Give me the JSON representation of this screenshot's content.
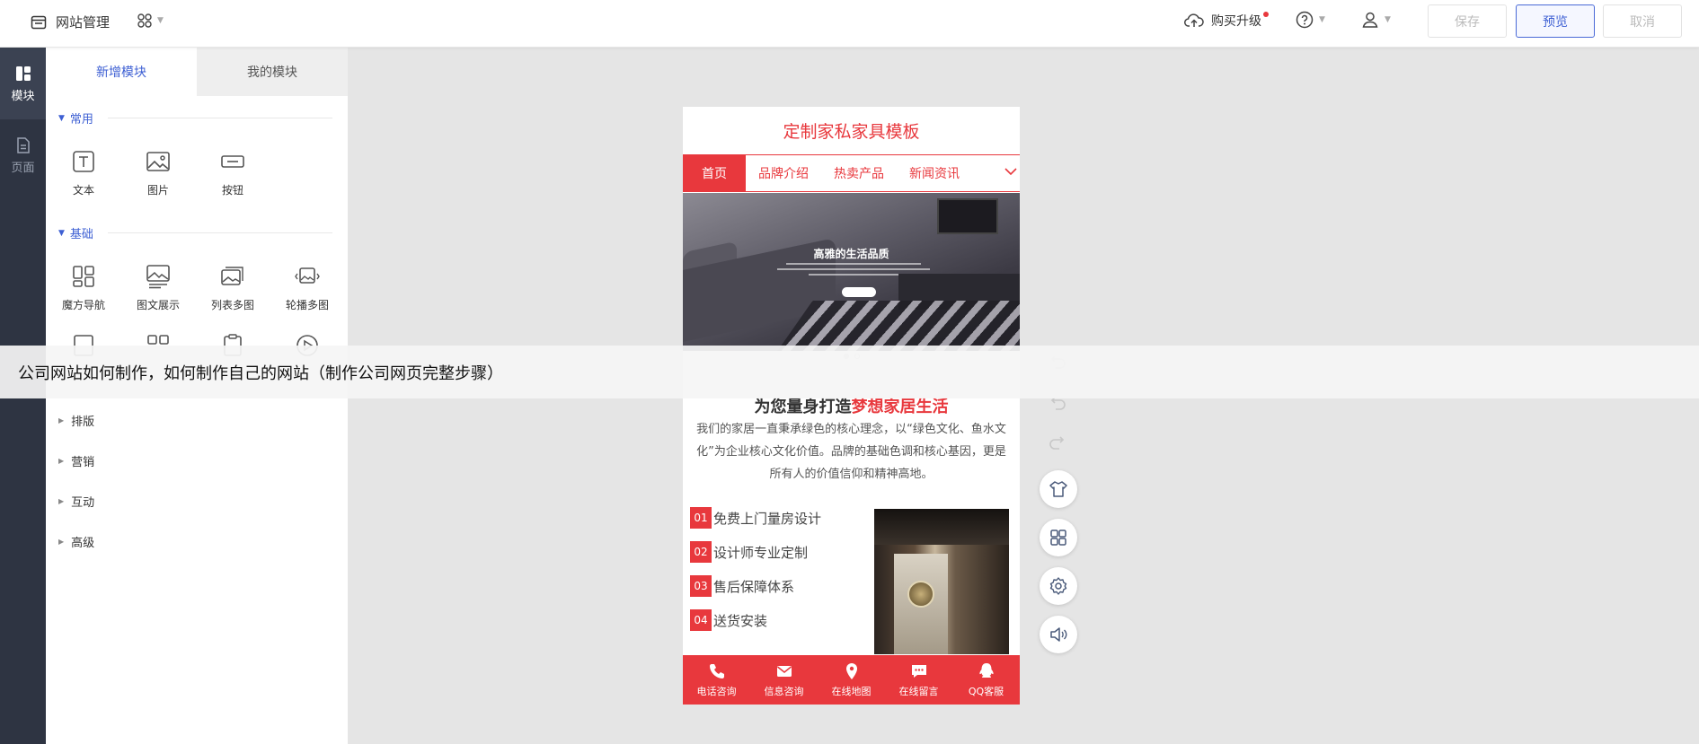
{
  "header": {
    "title": "网站管理",
    "upgrade_label": "购买升级",
    "save_label": "保存",
    "preview_label": "预览",
    "cancel_label": "取消"
  },
  "rail": {
    "items": [
      {
        "label": "模块",
        "icon": "module-icon"
      },
      {
        "label": "页面",
        "icon": "page-icon"
      }
    ]
  },
  "panel": {
    "tabs": [
      "新增模块",
      "我的模块"
    ],
    "sections": {
      "common": {
        "title": "常用",
        "items": [
          "文本",
          "图片",
          "按钮"
        ]
      },
      "basic": {
        "title": "基础",
        "items": [
          "魔方导航",
          "图文展示",
          "列表多图",
          "轮播多图"
        ]
      },
      "collapsed": [
        "排版",
        "营销",
        "互动",
        "高级"
      ]
    }
  },
  "phone": {
    "site_title": "定制家私家具模板",
    "nav": [
      "首页",
      "品牌介绍",
      "热卖产品",
      "新闻资讯"
    ],
    "banner_title": "高雅的生活品质",
    "slogan_black": "为您量身打造",
    "slogan_red": "梦想家居生活",
    "intro": "我们的家居一直秉承绿色的核心理念，以“绿色文化、鱼水文化”为企业核心文化价值。品牌的基础色调和核心基因，更是所有人的价值信仰和精神高地。",
    "features": [
      {
        "num": "01",
        "text": "免费上门量房设计"
      },
      {
        "num": "02",
        "text": "设计师专业定制"
      },
      {
        "num": "03",
        "text": "售后保障体系"
      },
      {
        "num": "04",
        "text": "送货安装"
      }
    ],
    "bottom_bar": [
      "电话咨询",
      "信息咨询",
      "在线地图",
      "在线留言",
      "QQ客服"
    ]
  },
  "overlay_caption": "公司网站如何制作，如何制作自己的网站（制作公司网页完整步骤）",
  "colors": {
    "accent_blue": "#3d5fd3",
    "brand_red": "#e8383d",
    "rail_dark": "#2e3442"
  }
}
